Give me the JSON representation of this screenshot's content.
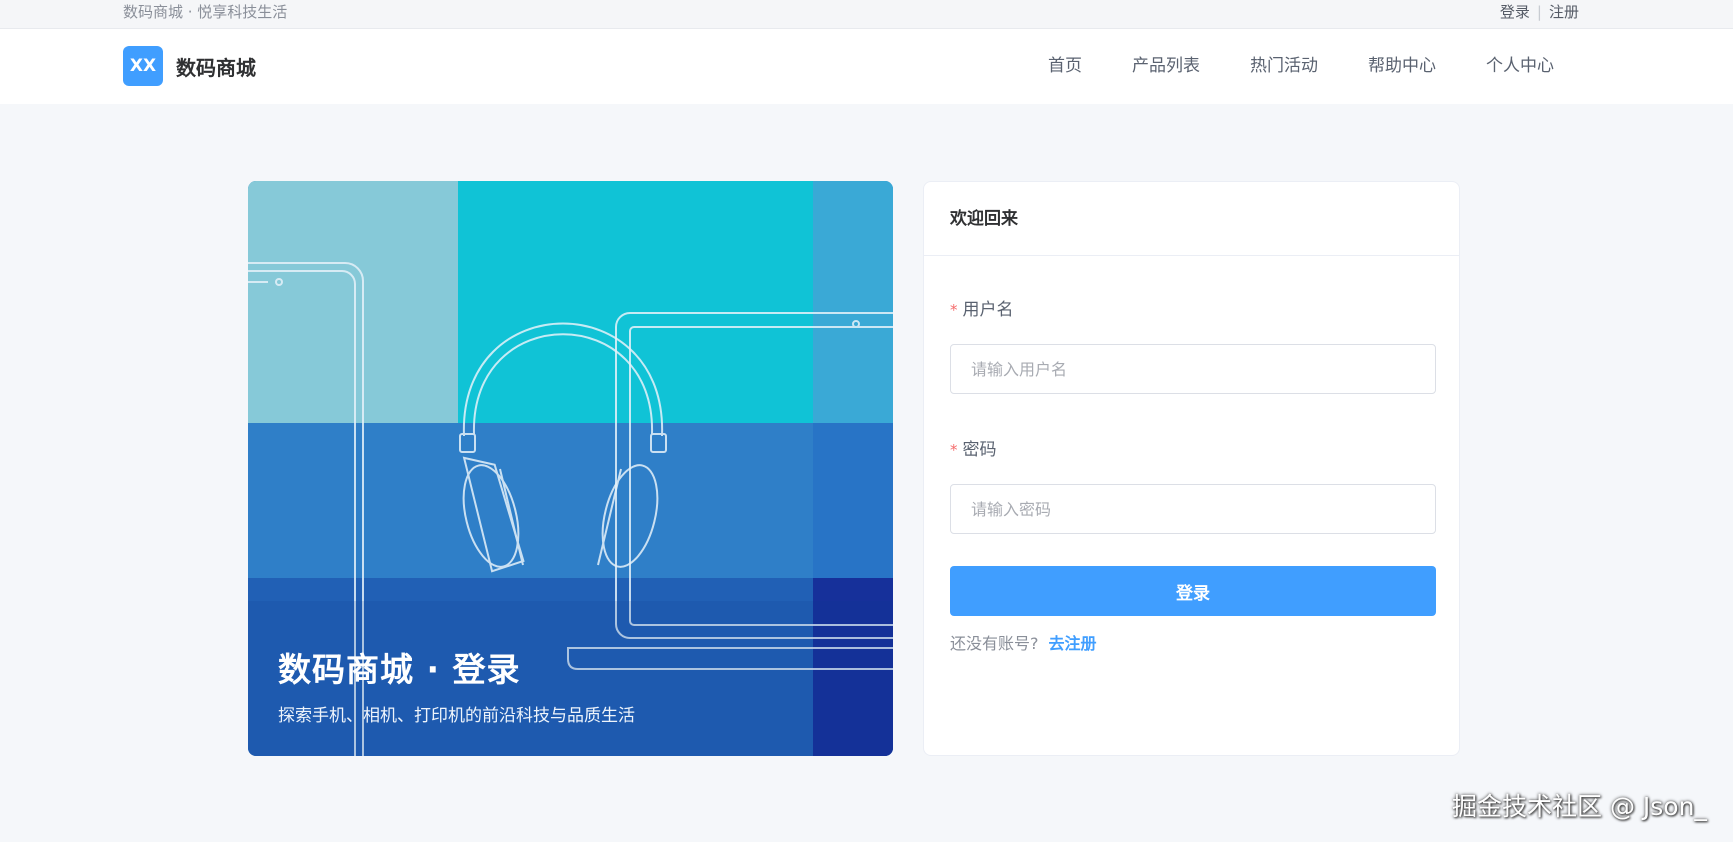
{
  "topbar": {
    "slogan": "数码商城 · 悦享科技生活",
    "login_link": "登录",
    "separator": "|",
    "register_link": "注册"
  },
  "header": {
    "logo_badge": "XX",
    "logo_text": "数码商城",
    "nav": [
      "首页",
      "产品列表",
      "热门活动",
      "帮助中心",
      "个人中心"
    ]
  },
  "hero": {
    "title": "数码商城 · 登录",
    "subtitle": "探索手机、相机、打印机的前沿科技与品质生活"
  },
  "login_card": {
    "title": "欢迎回来",
    "required_mark": "*",
    "username_label": "用户名",
    "username_placeholder": "请输入用户名",
    "username_value": "",
    "password_label": "密码",
    "password_placeholder": "请输入密码",
    "password_value": "",
    "submit_label": "登录",
    "no_account_text": "还没有账号?",
    "register_link": "去注册"
  },
  "watermark": "掘金技术社区 @ Json_",
  "colors": {
    "primary": "#409eff",
    "required": "#f56c6c",
    "page_bg": "#f5f7fa"
  }
}
